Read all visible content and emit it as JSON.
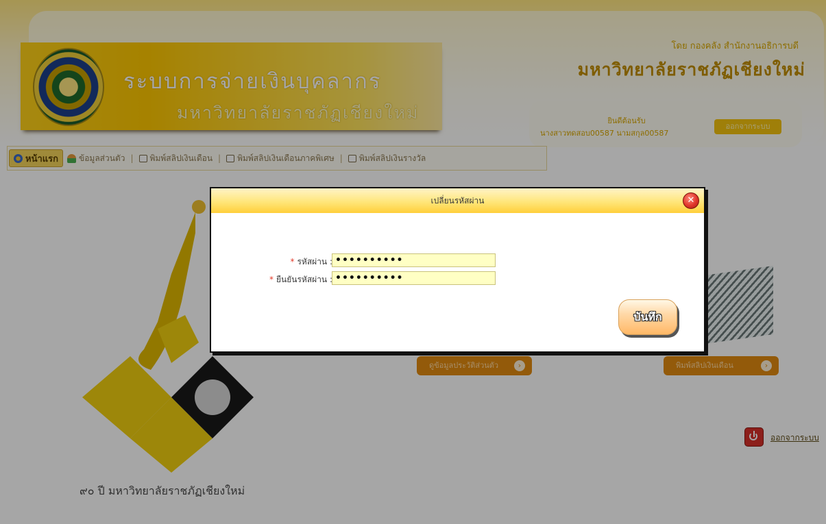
{
  "header": {
    "system_title": "ระบบการจ่ายเงินบุคลากร",
    "system_subtitle": "มหาวิทยาลัยราชภัฏเชียงใหม่",
    "by_line": "โดย กองคลัง สำนักงานอธิการบดี",
    "university_name": "มหาวิทยาลัยราชภัฏเชียงใหม่",
    "welcome_label": "ยินดีต้อนรับ",
    "welcome_user": "นางสาวทดสอบ00587 นามสกุล00587",
    "logout_button": "ออกจากระบบ"
  },
  "nav": {
    "items": [
      {
        "label": "หน้าแรก",
        "icon": "home-icon"
      },
      {
        "label": "ข้อมูลส่วนตัว",
        "icon": "user-icon"
      },
      {
        "label": "พิมพ์สลิปเงินเดือน",
        "icon": "printer-icon"
      },
      {
        "label": "พิมพ์สลิปเงินเดือนภาคพิเศษ",
        "icon": "printer-icon"
      },
      {
        "label": "พิมพ์สลิปเงินรางวัล",
        "icon": "printer-icon"
      }
    ]
  },
  "content": {
    "card_profile_label": "ดูข้อมูลประวัติส่วนตัว",
    "card_slip_label": "พิมพ์สลิปเงินเดือน",
    "logout_link": "ออกจากระบบ",
    "footer_caption": "๙๐ ปี มหาวิทยาลัยราชภัฏเชียงใหม่"
  },
  "dialog": {
    "title": "เปลี่ยนรหัสผ่าน",
    "password_label": "รหัสผ่าน :",
    "password_value": "••••••••••",
    "confirm_label": "ยืนยันรหัสผ่าน :",
    "confirm_value": "••••••••••",
    "required_mark": "*",
    "save_button": "บันทึก",
    "close_icon": "close-icon"
  },
  "colors": {
    "accent_yellow": "#ffc800",
    "dialog_title_bg": "#ffe67a",
    "input_bg": "#ffffc4",
    "button_orange": "#e28b10",
    "required_red": "#e23a2a"
  }
}
